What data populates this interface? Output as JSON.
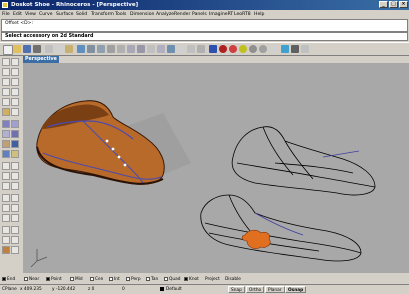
{
  "window": {
    "title": "Doskot Shoe - Rhinoceros - [Perspective]",
    "min": "_",
    "max": "□",
    "close": "×"
  },
  "menu": [
    "File",
    "Edit",
    "View",
    "Curve",
    "Surface",
    "Solid",
    "Transform",
    "Tools",
    "Dimension",
    "Analyze",
    "Render",
    "Panels",
    "ImagineRT",
    "LeoRT8",
    "Help"
  ],
  "command_history": "Offset <D>:",
  "command_prompt": "Select accessory on 2d Standard",
  "viewport": {
    "label": "Perspective",
    "shoe_colors": {
      "leather": "#b86a2a",
      "lining": "#4a4ab0",
      "accent": "#e07020"
    }
  },
  "osnaps": [
    {
      "label": "End",
      "checked": true
    },
    {
      "label": "Near",
      "checked": false
    },
    {
      "label": "Point",
      "checked": true
    },
    {
      "label": "Mid",
      "checked": false
    },
    {
      "label": "Cen",
      "checked": false
    },
    {
      "label": "Int",
      "checked": false
    },
    {
      "label": "Perp",
      "checked": false
    },
    {
      "label": "Tan",
      "checked": false
    },
    {
      "label": "Quad",
      "checked": false
    },
    {
      "label": "Knot",
      "checked": true
    },
    {
      "label": "Project",
      "checked": false
    },
    {
      "label": "Disable",
      "checked": false
    }
  ],
  "status": {
    "cplane": "CPlane",
    "x": "x 409.235",
    "y": "y -120.442",
    "z": "z 0",
    "layer_value": "0",
    "layer": "Default",
    "snap": "Snap",
    "ortho": "Ortho",
    "planar": "Planar",
    "osnap": "Osnap"
  }
}
